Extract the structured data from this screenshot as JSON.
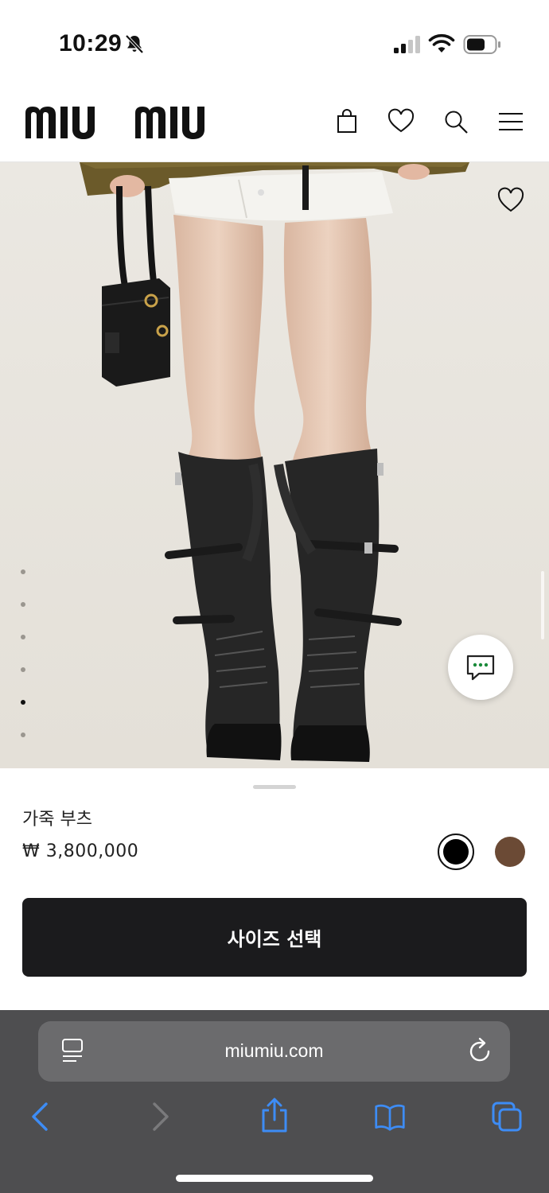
{
  "status_bar": {
    "time": "10:29",
    "icons": [
      "bell-slash-icon",
      "cellular-signal-icon",
      "wifi-icon",
      "battery-icon"
    ]
  },
  "header": {
    "logo_text": "miu miu",
    "icons": [
      "shopping-bag-icon",
      "heart-icon",
      "search-icon",
      "menu-icon"
    ]
  },
  "gallery": {
    "image_count": 6,
    "active_index": 4,
    "wishlist_icon": "heart-outline-icon",
    "chat_icon": "chat-bubble-icon"
  },
  "product": {
    "name": "가죽 부츠",
    "price": "₩ 3,800,000",
    "colors": [
      {
        "name": "black",
        "hex": "#000000",
        "selected": true
      },
      {
        "name": "brown",
        "hex": "#6B4A35",
        "selected": false
      }
    ],
    "select_size_label": "사이즈 선택"
  },
  "browser": {
    "url": "miumiu.com",
    "toolbar_icons": [
      "back-icon",
      "forward-icon",
      "share-icon",
      "bookmarks-icon",
      "tabs-icon"
    ]
  }
}
